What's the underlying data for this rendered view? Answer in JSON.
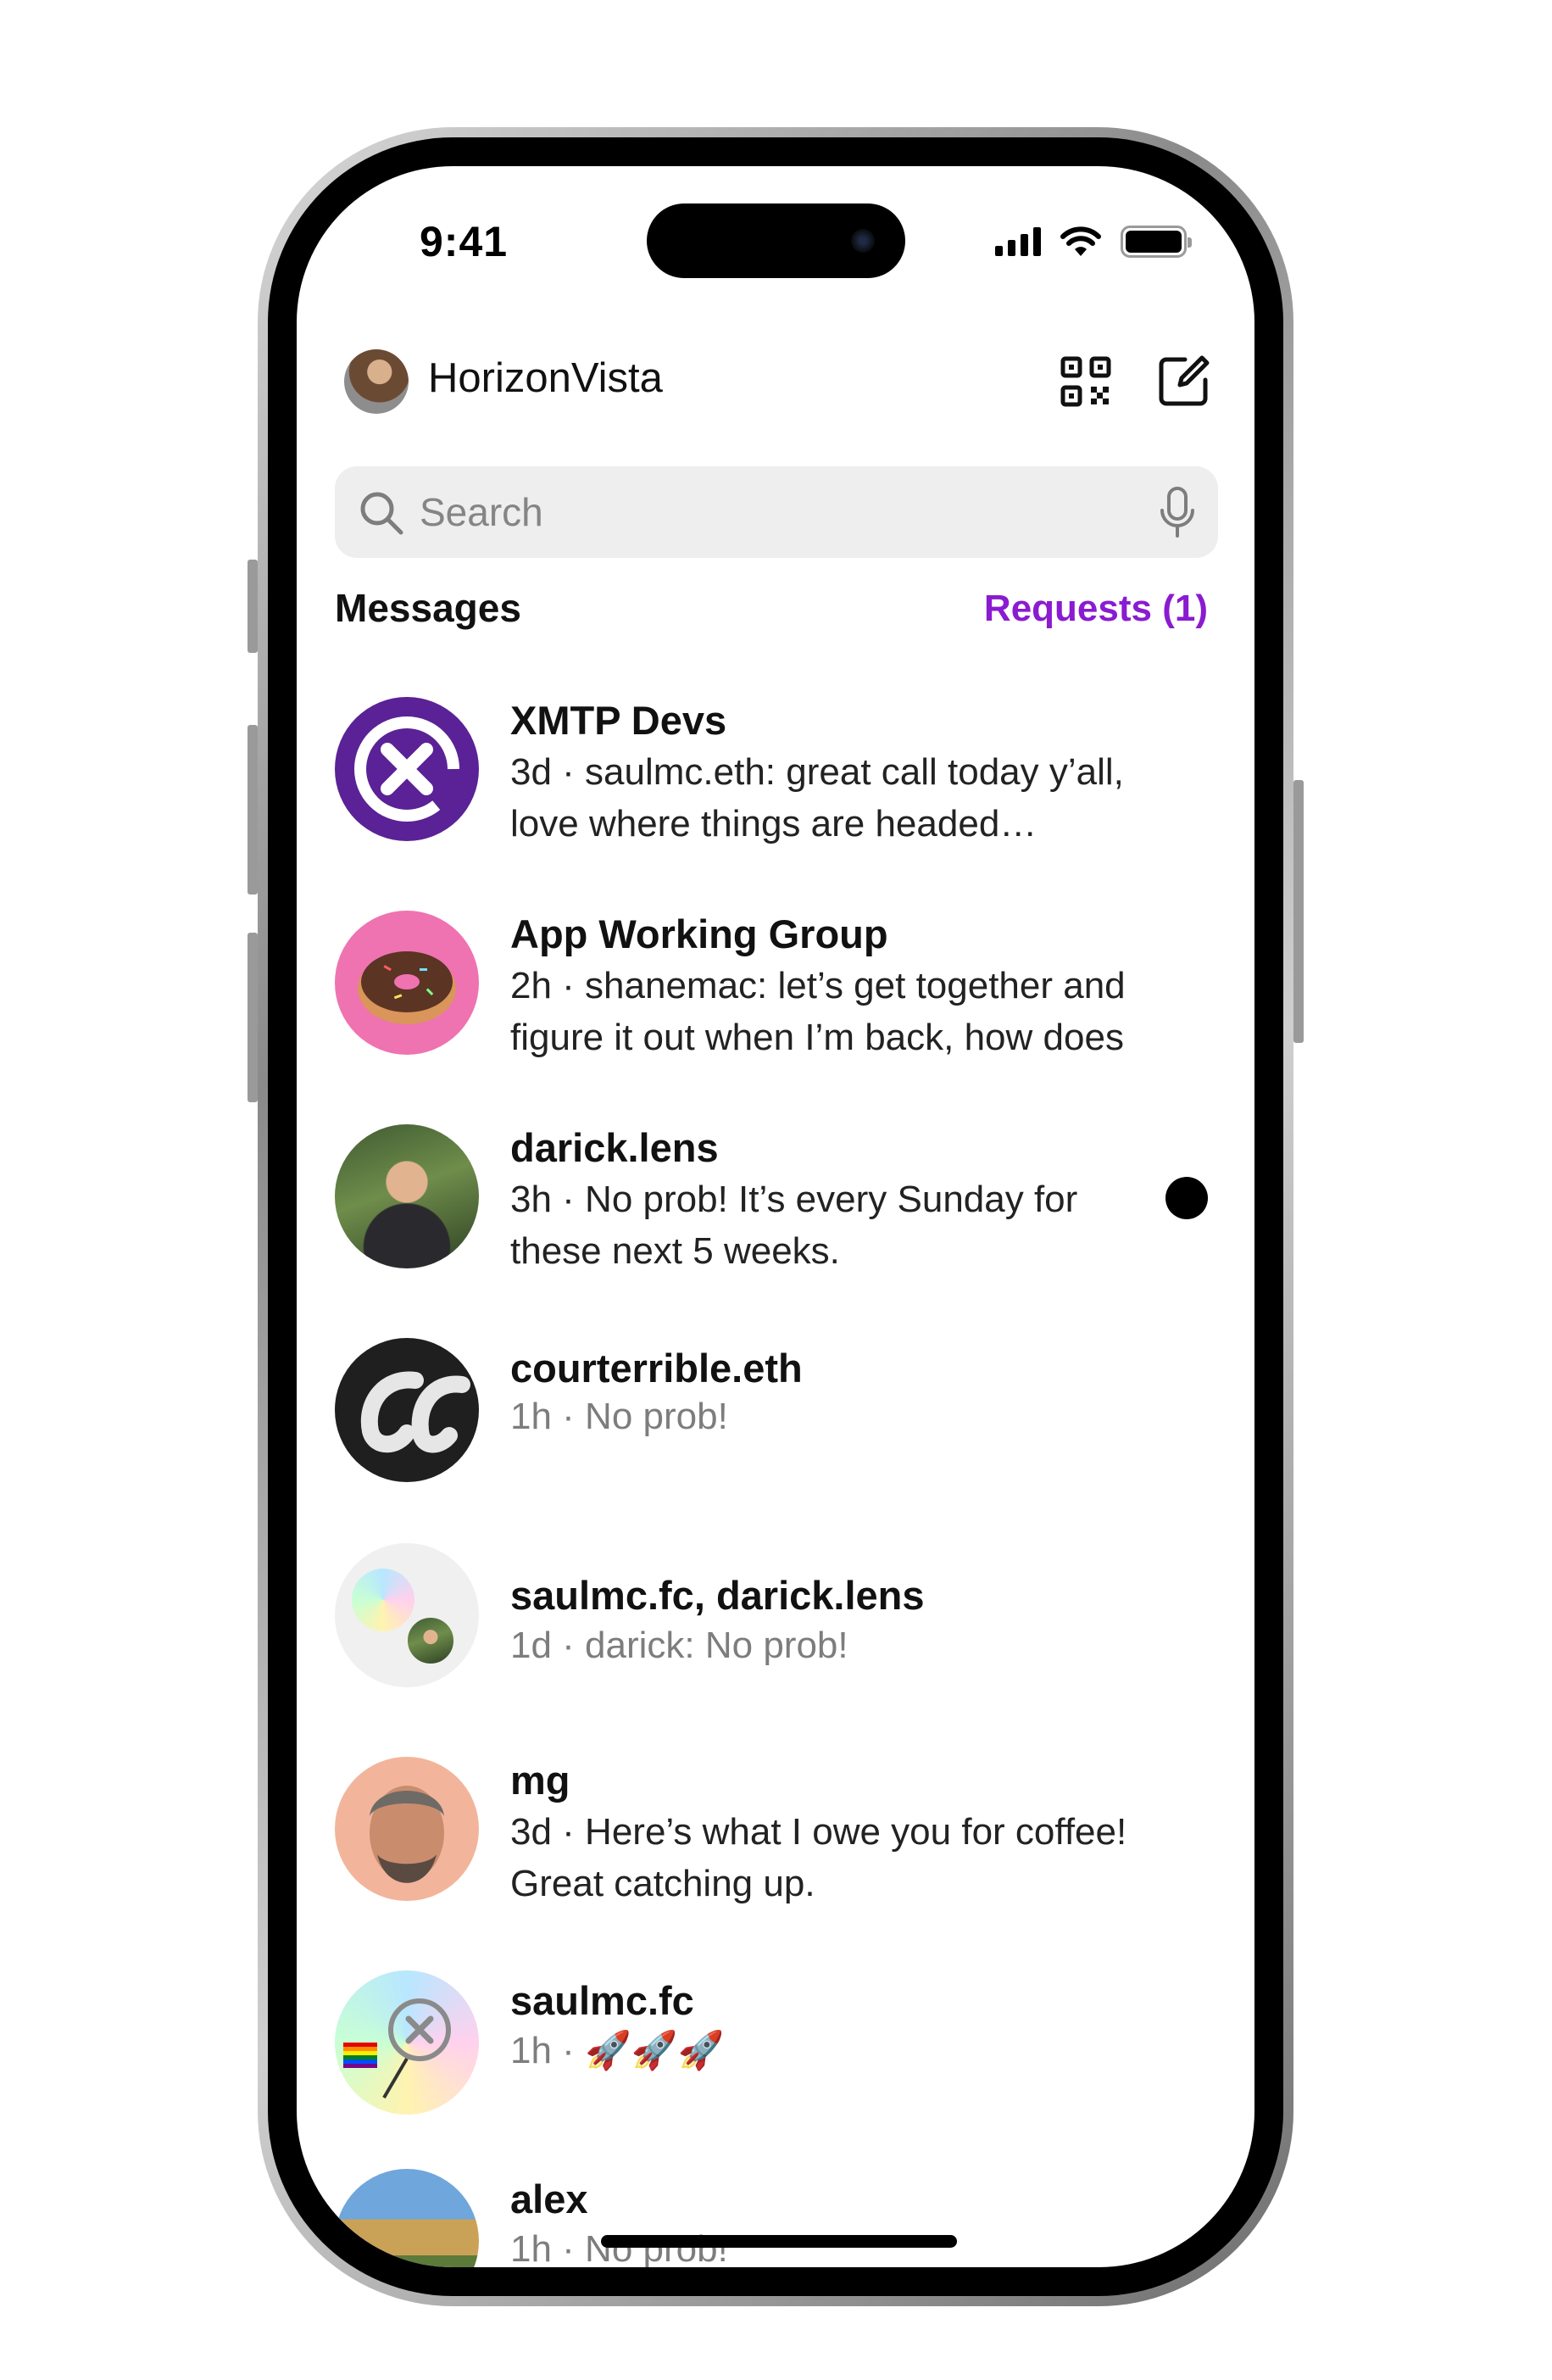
{
  "status_bar": {
    "time": "9:41"
  },
  "header": {
    "username": "HorizonVista"
  },
  "search": {
    "placeholder": "Search"
  },
  "section": {
    "title": "Messages",
    "requests_label": "Requests (1)"
  },
  "conversations": [
    {
      "title": "XMTP Devs",
      "preview": "3d · saulmc.eth: great call today y’all, love where things are headed…",
      "muted": false,
      "unread": false,
      "avatar": "xmtp-logo"
    },
    {
      "title": "App Working Group",
      "preview": "2h · shanemac: let’s get together and figure it out when I’m back, how does",
      "muted": false,
      "unread": false,
      "avatar": "donut"
    },
    {
      "title": "darick.lens",
      "preview": "3h · No prob! It’s every Sunday for these next 5 weeks.",
      "muted": false,
      "unread": true,
      "avatar": "photo"
    },
    {
      "title": "courterrible.eth",
      "preview": "1h · No prob!",
      "muted": true,
      "unread": false,
      "avatar": "script-logo"
    },
    {
      "title": "saulmc.fc, darick.lens",
      "preview": "1d · darick: No prob!",
      "muted": true,
      "unread": false,
      "avatar": "group"
    },
    {
      "title": "mg",
      "preview": "3d · Here’s what I owe you for coffee! Great catching up.",
      "muted": false,
      "unread": false,
      "avatar": "photo"
    },
    {
      "title": "saulmc.fc",
      "preview": "1h · 🚀🚀🚀",
      "muted": true,
      "unread": false,
      "avatar": "xmtp-pride"
    },
    {
      "title": "alex",
      "preview": "1h · No prob!",
      "muted": true,
      "unread": false,
      "avatar": "photo"
    }
  ],
  "colors": {
    "accent": "#8a1bd1",
    "xmtp_purple": "#5a2296",
    "search_bg": "#eeeeef"
  }
}
